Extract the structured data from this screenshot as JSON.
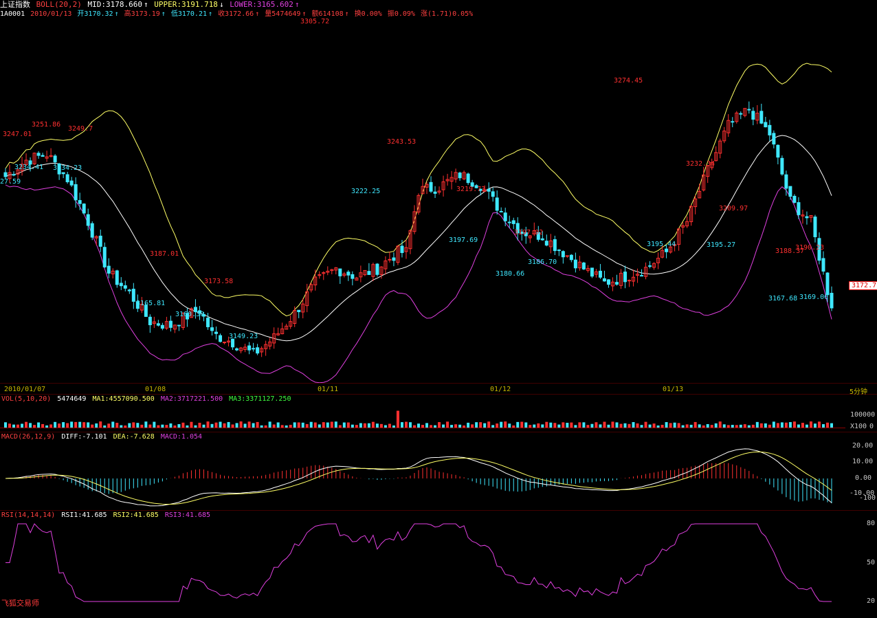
{
  "header": {
    "title": "上证指数",
    "indicator": "BOLL(20,2)",
    "mid": "MID:3178.660",
    "upper": "UPPER:3191.718",
    "lower": "LOWER:3165.602",
    "code": "1A0001",
    "date": "2010/01/13",
    "open": "开3170.32",
    "high": "高3173.19",
    "low": "低3170.21",
    "close": "收3172.66",
    "volume": "量5474649",
    "amount": "额614108",
    "turnover": "换0.00%",
    "amplitude": "振0.09%",
    "change": "涨(1.71)0.05%"
  },
  "colors": {
    "up": "#ff3030",
    "down": "#3fe8ff",
    "mid": "#ffffff",
    "upper": "#ffff66",
    "lower": "#e040e0"
  },
  "x_axis": {
    "dates": [
      "2010/01/07",
      "01/08",
      "01/11",
      "01/12",
      "01/13"
    ],
    "period": "5分钟"
  },
  "volume_panel": {
    "label": "VOL(5,10,20)",
    "vol": "5474649",
    "ma1": "MA1:4557090.500",
    "ma2": "MA2:3717221.500",
    "ma3": "MA3:3371127.250",
    "axis_top": "100000",
    "axis_unit": "X100",
    "axis_zero": "0"
  },
  "macd_panel": {
    "label": "MACD(26,12,9)",
    "diff": "DIFF:-7.101",
    "dea": "DEA:-7.628",
    "macd": "MACD:1.054",
    "axis": [
      "20.00",
      "10.00",
      "0.00",
      "-10.00"
    ],
    "axis_extra": "-100"
  },
  "rsi_panel": {
    "label": "RSI(14,14,14)",
    "rsi1": "RSI1:41.685",
    "rsi2": "RSI2:41.685",
    "rsi3": "RSI3:41.685",
    "axis": [
      "80",
      "50",
      "20"
    ]
  },
  "brand": "飞狐交易师",
  "current_price": "3172.7",
  "chart_data": {
    "type": "candlestick",
    "title": "上证指数",
    "price_annotations": {
      "high": [
        "3247.01",
        "3251.86",
        "3249.7",
        "3187.01",
        "3173.58",
        "3305.72",
        "3243.53",
        "3219.73",
        "3197.02",
        "3274.45",
        "3232.34",
        "3209.97",
        "3188.37",
        "3190.23"
      ],
      "low": [
        "27.59",
        "3234.41",
        "3234.23",
        "3165.81",
        "3160.30",
        "3149.23",
        "3222.25",
        "3197.69",
        "3180.66",
        "3186.70",
        "3195.44",
        "3195.27",
        "3167.68",
        "3169.06"
      ]
    },
    "key_points": {
      "x": [
        0,
        5,
        10,
        15,
        20,
        25,
        30,
        35,
        40,
        45,
        47,
        50,
        55,
        60,
        65,
        70,
        75,
        80,
        85,
        90,
        95,
        97,
        100,
        105,
        110,
        115,
        120,
        125,
        130,
        135,
        140,
        145,
        150,
        155,
        160,
        165,
        170,
        175,
        180,
        185,
        190,
        195,
        200
      ],
      "price": [
        3237,
        3245,
        3248,
        3236,
        3215,
        3190,
        3180,
        3166,
        3164,
        3170,
        3172,
        3160,
        3156,
        3150,
        3158,
        3170,
        3185,
        3192,
        3188,
        3192,
        3200,
        3200,
        3230,
        3232,
        3238,
        3233,
        3220,
        3210,
        3208,
        3200,
        3192,
        3185,
        3188,
        3192,
        3200,
        3215,
        3240,
        3262,
        3270,
        3258,
        3225,
        3215,
        3172.66
      ]
    },
    "ylim": [
      3140,
      3310
    ]
  }
}
